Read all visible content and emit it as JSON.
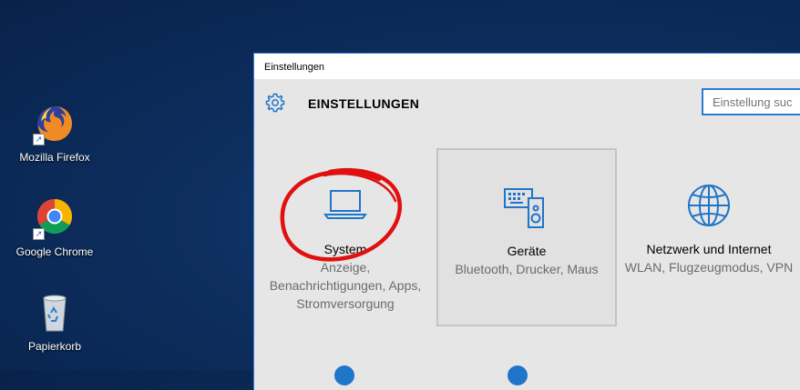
{
  "desktop": {
    "icons": [
      {
        "label": "Mozilla Firefox"
      },
      {
        "label": "Google Chrome"
      },
      {
        "label": "Papierkorb"
      }
    ]
  },
  "window": {
    "title": "Einstellungen",
    "header": "EINSTELLUNGEN",
    "search_placeholder": "Einstellung suc",
    "tiles": [
      {
        "name": "System",
        "desc": "Anzeige, Benachrichtigungen, Apps, Stromversorgung",
        "icon": "laptop-icon"
      },
      {
        "name": "Geräte",
        "desc": "Bluetooth, Drucker, Maus",
        "icon": "devices-icon"
      },
      {
        "name": "Netzwerk und Internet",
        "desc": "WLAN, Flugzeugmodus, VPN",
        "icon": "globe-icon"
      }
    ]
  },
  "colors": {
    "accent": "#1f75c8",
    "annotation": "#e01010"
  }
}
